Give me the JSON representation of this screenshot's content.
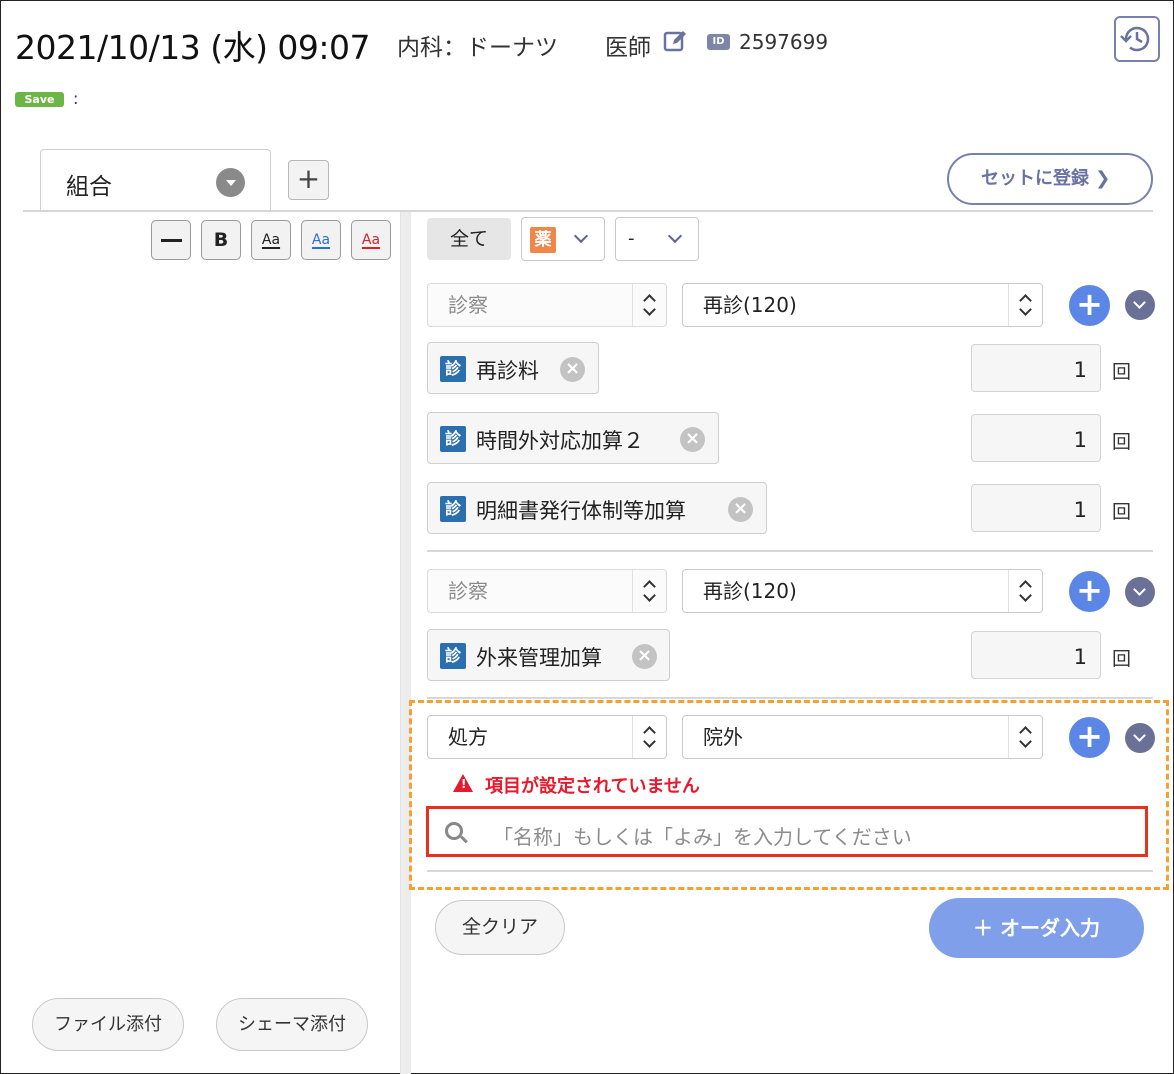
{
  "header": {
    "datetime": "2021/10/13 (水) 09:07",
    "department": "内科：ドーナツ",
    "role": "医師",
    "id_badge": "ID",
    "patient_id": "2597699",
    "save_badge": "Save",
    "save_mark": ":"
  },
  "tabs": {
    "active_label": "組合",
    "add_label": "+",
    "set_register_label": "セットに登録 ❯"
  },
  "editor": {
    "toolbar": [
      "—",
      "B",
      "Aa",
      "Aa",
      "Aa"
    ],
    "colors": {
      "blue": "#2a6fd8",
      "red": "#d8202a",
      "black": "#222222"
    },
    "file_attach_label": "ファイル添付",
    "schema_attach_label": "シェーマ添付"
  },
  "filters": {
    "all_label": "全て",
    "category_icon": "薬",
    "second_value": "-"
  },
  "groups": [
    {
      "category": "診察",
      "type": "再診(120)",
      "items": [
        {
          "icon": "診",
          "label": "再診料",
          "qty": "1",
          "unit": "回"
        },
        {
          "icon": "診",
          "label": "時間外対応加算２",
          "qty": "1",
          "unit": "回"
        },
        {
          "icon": "診",
          "label": "明細書発行体制等加算",
          "qty": "1",
          "unit": "回"
        }
      ]
    },
    {
      "category": "診察",
      "type": "再診(120)",
      "items": [
        {
          "icon": "診",
          "label": "外来管理加算",
          "qty": "1",
          "unit": "回"
        }
      ]
    }
  ],
  "prescription": {
    "category": "処方",
    "type": "院外",
    "warning": "項目が設定されていません",
    "search_placeholder": "「名称」もしくは「よみ」を入力してください",
    "accent": "#f5a030",
    "error_color": "#e8192c"
  },
  "footer": {
    "clear_label": "全クリア",
    "order_label": "＋ オーダ入力",
    "order_color": "#7f9feb"
  }
}
